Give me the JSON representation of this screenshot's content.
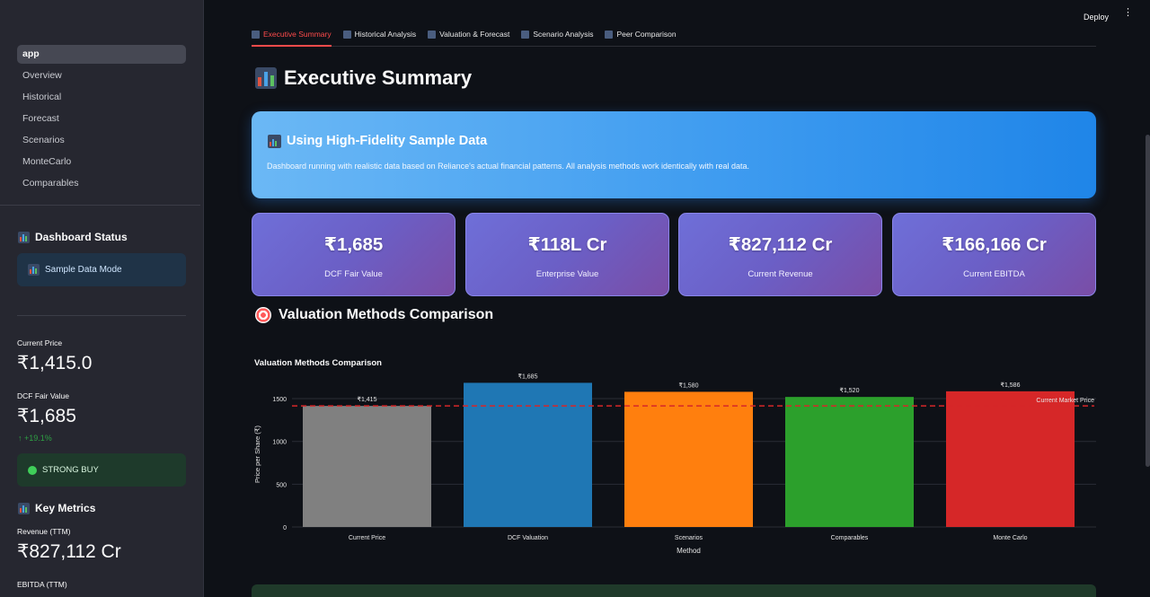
{
  "header": {
    "deploy_label": "Deploy",
    "menu_icon": "⋮"
  },
  "sidebar": {
    "nav": [
      {
        "label": "app",
        "active": true
      },
      {
        "label": "Overview"
      },
      {
        "label": "Historical"
      },
      {
        "label": "Forecast"
      },
      {
        "label": "Scenarios"
      },
      {
        "label": "MonteCarlo"
      },
      {
        "label": "Comparables"
      }
    ],
    "status_heading": "Dashboard Status",
    "status_box": "Sample Data Mode",
    "current_price_label": "Current Price",
    "current_price_value": "₹1,415.0",
    "dcf_label": "DCF Fair Value",
    "dcf_value": "₹1,685",
    "dcf_delta": "↑ +19.1%",
    "recommendation": "STRONG BUY",
    "key_metrics_heading": "Key Metrics",
    "revenue_label": "Revenue (TTM)",
    "revenue_value": "₹827,112 Cr",
    "ebitda_label": "EBITDA (TTM)"
  },
  "tabs": [
    {
      "label": "Executive Summary",
      "active": true
    },
    {
      "label": "Historical Analysis"
    },
    {
      "label": "Valuation & Forecast"
    },
    {
      "label": "Scenario Analysis"
    },
    {
      "label": "Peer Comparison"
    }
  ],
  "page_title": "Executive Summary",
  "banner": {
    "title": "Using High-Fidelity Sample Data",
    "text": "Dashboard running with realistic data based on Reliance's actual financial patterns. All analysis methods work identically with real data."
  },
  "cards": [
    {
      "value": "₹1,685",
      "label": "DCF Fair Value"
    },
    {
      "value": "₹118L Cr",
      "label": "Enterprise Value"
    },
    {
      "value": "₹827,112 Cr",
      "label": "Current Revenue"
    },
    {
      "value": "₹166,166 Cr",
      "label": "Current EBITDA"
    }
  ],
  "section_title": "Valuation Methods Comparison",
  "colors": {
    "accent": "#ff4b4b",
    "bar_colors": [
      "#808080",
      "#1f77b4",
      "#ff7f0e",
      "#2ca02c",
      "#d62728"
    ],
    "reference_line": "#d62728"
  },
  "chart_data": {
    "type": "bar",
    "title": "Valuation Methods Comparison",
    "xlabel": "Method",
    "ylabel": "Price per Share (₹)",
    "categories": [
      "Current Price",
      "DCF Valuation",
      "Scenarios",
      "Comparables",
      "Monte Carlo"
    ],
    "values": [
      1415,
      1685,
      1580,
      1520,
      1586
    ],
    "data_labels": [
      "₹1,415",
      "₹1,685",
      "₹1,580",
      "₹1,520",
      "₹1,586"
    ],
    "yticks": [
      0,
      500,
      1000,
      1500
    ],
    "ylim": [
      0,
      1700
    ],
    "reference_line": {
      "value": 1415,
      "label": "Current Market Price"
    },
    "grid": true,
    "legend": "none"
  }
}
